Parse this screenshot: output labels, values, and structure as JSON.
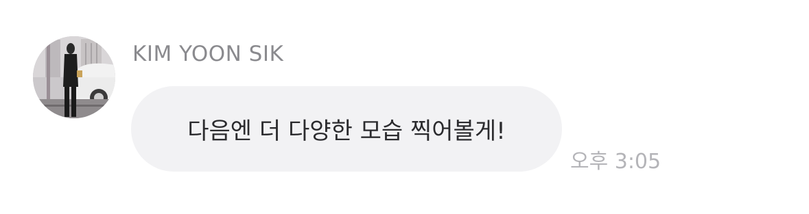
{
  "message": {
    "sender_name": "KIM YOON SIK",
    "avatar": "profile-photo",
    "text": "다음엔 더 다양한 모습 찍어볼게!",
    "time": "오후 3:05"
  },
  "colors": {
    "bubble_bg": "#f2f2f4",
    "sender_name": "#8a8a8e",
    "message_text": "#2b2b2e",
    "timestamp": "#b4b4b8"
  }
}
